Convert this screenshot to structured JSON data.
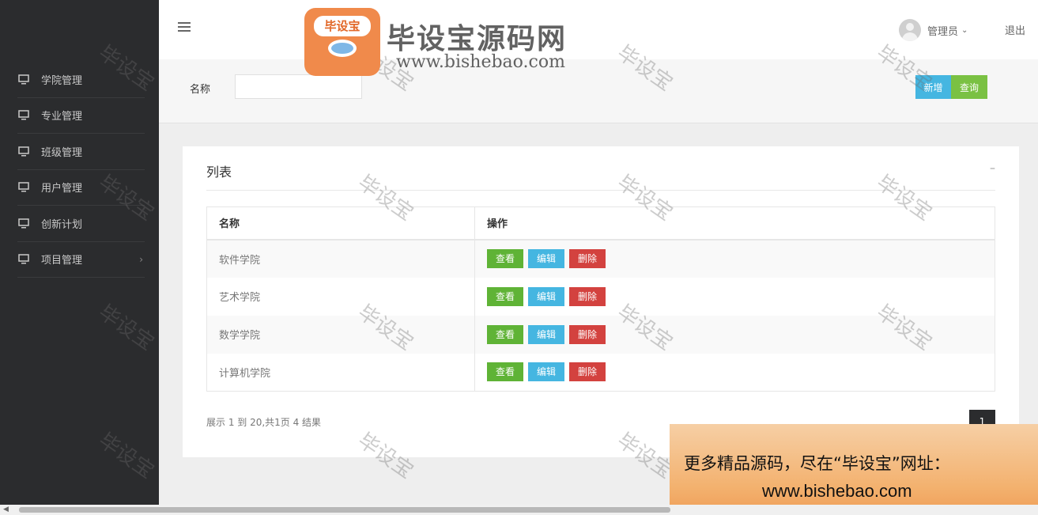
{
  "sidebar": {
    "items": [
      {
        "label": "学院管理",
        "icon": "monitor-icon"
      },
      {
        "label": "专业管理",
        "icon": "monitor-icon"
      },
      {
        "label": "班级管理",
        "icon": "monitor-icon"
      },
      {
        "label": "用户管理",
        "icon": "monitor-icon"
      },
      {
        "label": "创新计划",
        "icon": "monitor-icon"
      },
      {
        "label": "项目管理",
        "icon": "monitor-icon",
        "has_submenu": true
      }
    ]
  },
  "header": {
    "user_name": "管理员",
    "logout_label": "退出"
  },
  "search": {
    "name_label": "名称",
    "name_value": "",
    "add_label": "新增",
    "query_label": "查询"
  },
  "list": {
    "title": "列表",
    "collapse_label": "–",
    "columns": [
      "名称",
      "操作"
    ],
    "rows": [
      {
        "name": "软件学院"
      },
      {
        "name": "艺术学院"
      },
      {
        "name": "数学学院"
      },
      {
        "name": "计算机学院"
      }
    ],
    "actions": {
      "view": "查看",
      "edit": "编辑",
      "delete": "删除"
    }
  },
  "pagination": {
    "info": "展示 1 到 20,共1页 4 结果",
    "current_page": "1"
  },
  "watermark": {
    "text": "毕设宝",
    "logo_badge": "毕设宝",
    "logo_title": "毕设宝源码网",
    "logo_url": "www.bishebao.com"
  },
  "promo": {
    "line1": "更多精品源码，尽在“毕设宝”网址：",
    "line2": "www.bishebao.com"
  },
  "colors": {
    "sidebar_bg": "#2b2c2e",
    "view_button": "#5fb336",
    "edit_button": "#45b6e1",
    "delete_button": "#d3423f",
    "query_button": "#7ac143",
    "add_button": "#45b6e1"
  }
}
